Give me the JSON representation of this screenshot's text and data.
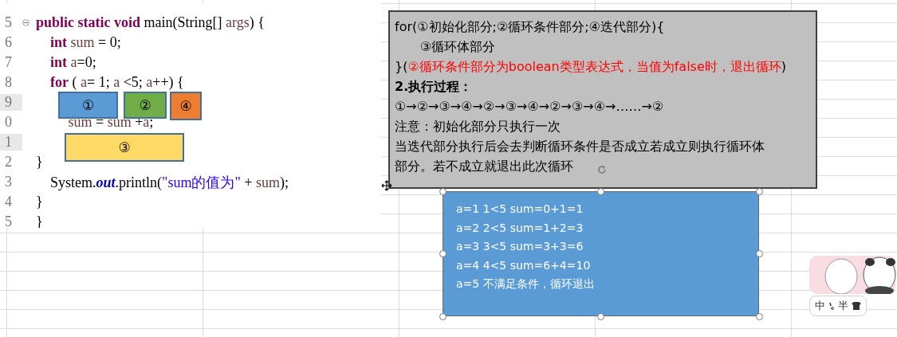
{
  "code_editor": {
    "lines": [
      {
        "number": "5",
        "fold": true,
        "segments": [
          {
            "kind": "keyword",
            "text": "public static void"
          },
          {
            "kind": "plain",
            "text": " main(String[] "
          },
          {
            "kind": "variable",
            "text": "args"
          },
          {
            "kind": "plain",
            "text": ") {"
          }
        ]
      },
      {
        "number": "6",
        "segments": [
          {
            "kind": "keyword",
            "text": "    int"
          },
          {
            "kind": "variable",
            "text": " sum"
          },
          {
            "kind": "plain",
            "text": " = 0;"
          }
        ]
      },
      {
        "number": "7",
        "segments": [
          {
            "kind": "keyword",
            "text": "    int"
          },
          {
            "kind": "variable",
            "text": " a"
          },
          {
            "kind": "plain",
            "text": "=0;"
          }
        ]
      },
      {
        "number": "8",
        "segments": [
          {
            "kind": "keyword",
            "text": "    for"
          },
          {
            "kind": "plain",
            "text": " ( "
          },
          {
            "kind": "variable",
            "text": "a"
          },
          {
            "kind": "plain",
            "text": "= 1; "
          },
          {
            "kind": "variable",
            "text": "a"
          },
          {
            "kind": "plain",
            "text": " <5; "
          },
          {
            "kind": "variable",
            "text": "a"
          },
          {
            "kind": "plain",
            "text": "++) {"
          }
        ]
      },
      {
        "number": "9"
      },
      {
        "number": "0",
        "segments": [
          {
            "kind": "variable",
            "text": "         sum"
          },
          {
            "kind": "plain",
            "text": " = "
          },
          {
            "kind": "variable",
            "text": "sum"
          },
          {
            "kind": "plain",
            "text": " +"
          },
          {
            "kind": "variable",
            "text": "a"
          },
          {
            "kind": "plain",
            "text": ";"
          }
        ]
      },
      {
        "number": "1"
      },
      {
        "number": "2",
        "segments": [
          {
            "kind": "plain",
            "text": "}"
          }
        ]
      },
      {
        "number": "3",
        "segments": [
          {
            "kind": "plain",
            "text": "    System."
          },
          {
            "kind": "field",
            "text": "out"
          },
          {
            "kind": "plain",
            "text": ".println("
          },
          {
            "kind": "string",
            "text": "\"sum的值为\""
          },
          {
            "kind": "plain",
            "text": " + "
          },
          {
            "kind": "variable",
            "text": "sum"
          },
          {
            "kind": "plain",
            "text": ");"
          }
        ]
      },
      {
        "number": "4",
        "segments": [
          {
            "kind": "plain",
            "text": "}"
          }
        ]
      },
      {
        "number": "5",
        "segments": [
          {
            "kind": "plain",
            "text": "}"
          }
        ]
      }
    ],
    "markers": [
      {
        "label": "①",
        "color": "#5b9bd5"
      },
      {
        "label": "②",
        "color": "#70ad47"
      },
      {
        "label": "④",
        "color": "#ed7d31"
      },
      {
        "label": "③",
        "color": "#ffd966"
      }
    ]
  },
  "note": {
    "lines": [
      {
        "kind": "text",
        "segments": [
          {
            "text": "for(①初始化部分;②循环条件部分;④迭代部分){"
          }
        ]
      },
      {
        "kind": "indented",
        "segments": [
          {
            "text": "③循环体部分"
          }
        ]
      },
      {
        "kind": "text",
        "segments": [
          {
            "text": "}("
          },
          {
            "text": "②循环条件部分为boolean类型表达式，当值为false时，退出循环",
            "color": "#ff0000"
          },
          {
            "text": ")"
          }
        ]
      },
      {
        "kind": "heading",
        "segments": [
          {
            "text": "2.执行过程："
          }
        ]
      },
      {
        "kind": "text",
        "segments": [
          {
            "text": "①→②→③→④→②→③→④→②→③→④→……→②"
          }
        ]
      },
      {
        "kind": "text",
        "segments": [
          {
            "text": "注意：初始化部分只执行一次"
          }
        ]
      },
      {
        "kind": "text",
        "segments": [
          {
            "text": "当迭代部分执行后会去判断循环条件是否成立若成立则执行循环体"
          }
        ]
      },
      {
        "kind": "text",
        "segments": [
          {
            "text": "部分。若不成立就退出此次循环"
          }
        ]
      }
    ]
  },
  "trace_box": {
    "selected": true,
    "lines": [
      "a=1 1<5 sum=0+1=1",
      "a=2 2<5 sum=1+2=3",
      "a=3 3<5 sum=3+3=6",
      "a=4 4<5 sum=6+4=10",
      "a=5 不满足条件，循环退出"
    ]
  },
  "ime_toolbar": {
    "mode": "中",
    "width": "半"
  }
}
